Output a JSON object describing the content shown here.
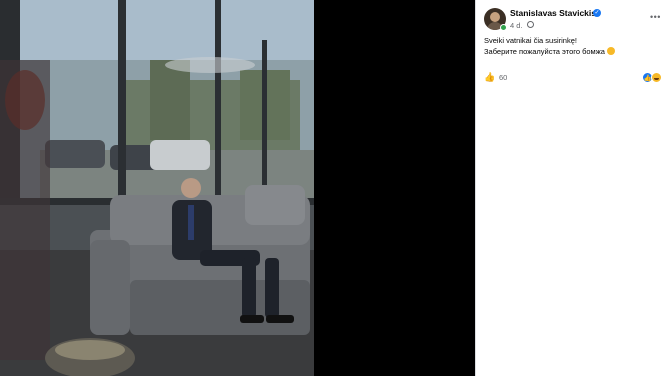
{
  "post": {
    "author": "Stanislavas Stavickis",
    "verified_icon": "verified-badge-icon",
    "time": "4 d.",
    "audience_icon": "globe-icon",
    "text_line1": "Sveiki vatnikai čia susirinkę!",
    "text_line2": "Заберите пожалуйста этого бомжа",
    "text_emoji": "smiling-emoji",
    "like_count": "60",
    "reactions": [
      "like",
      "haha"
    ]
  },
  "photo": {
    "description_icon": "photo"
  },
  "colors": {
    "accent": "#1877f2",
    "text_primary": "#050505",
    "text_secondary": "#65676b",
    "online": "#31a24c"
  }
}
